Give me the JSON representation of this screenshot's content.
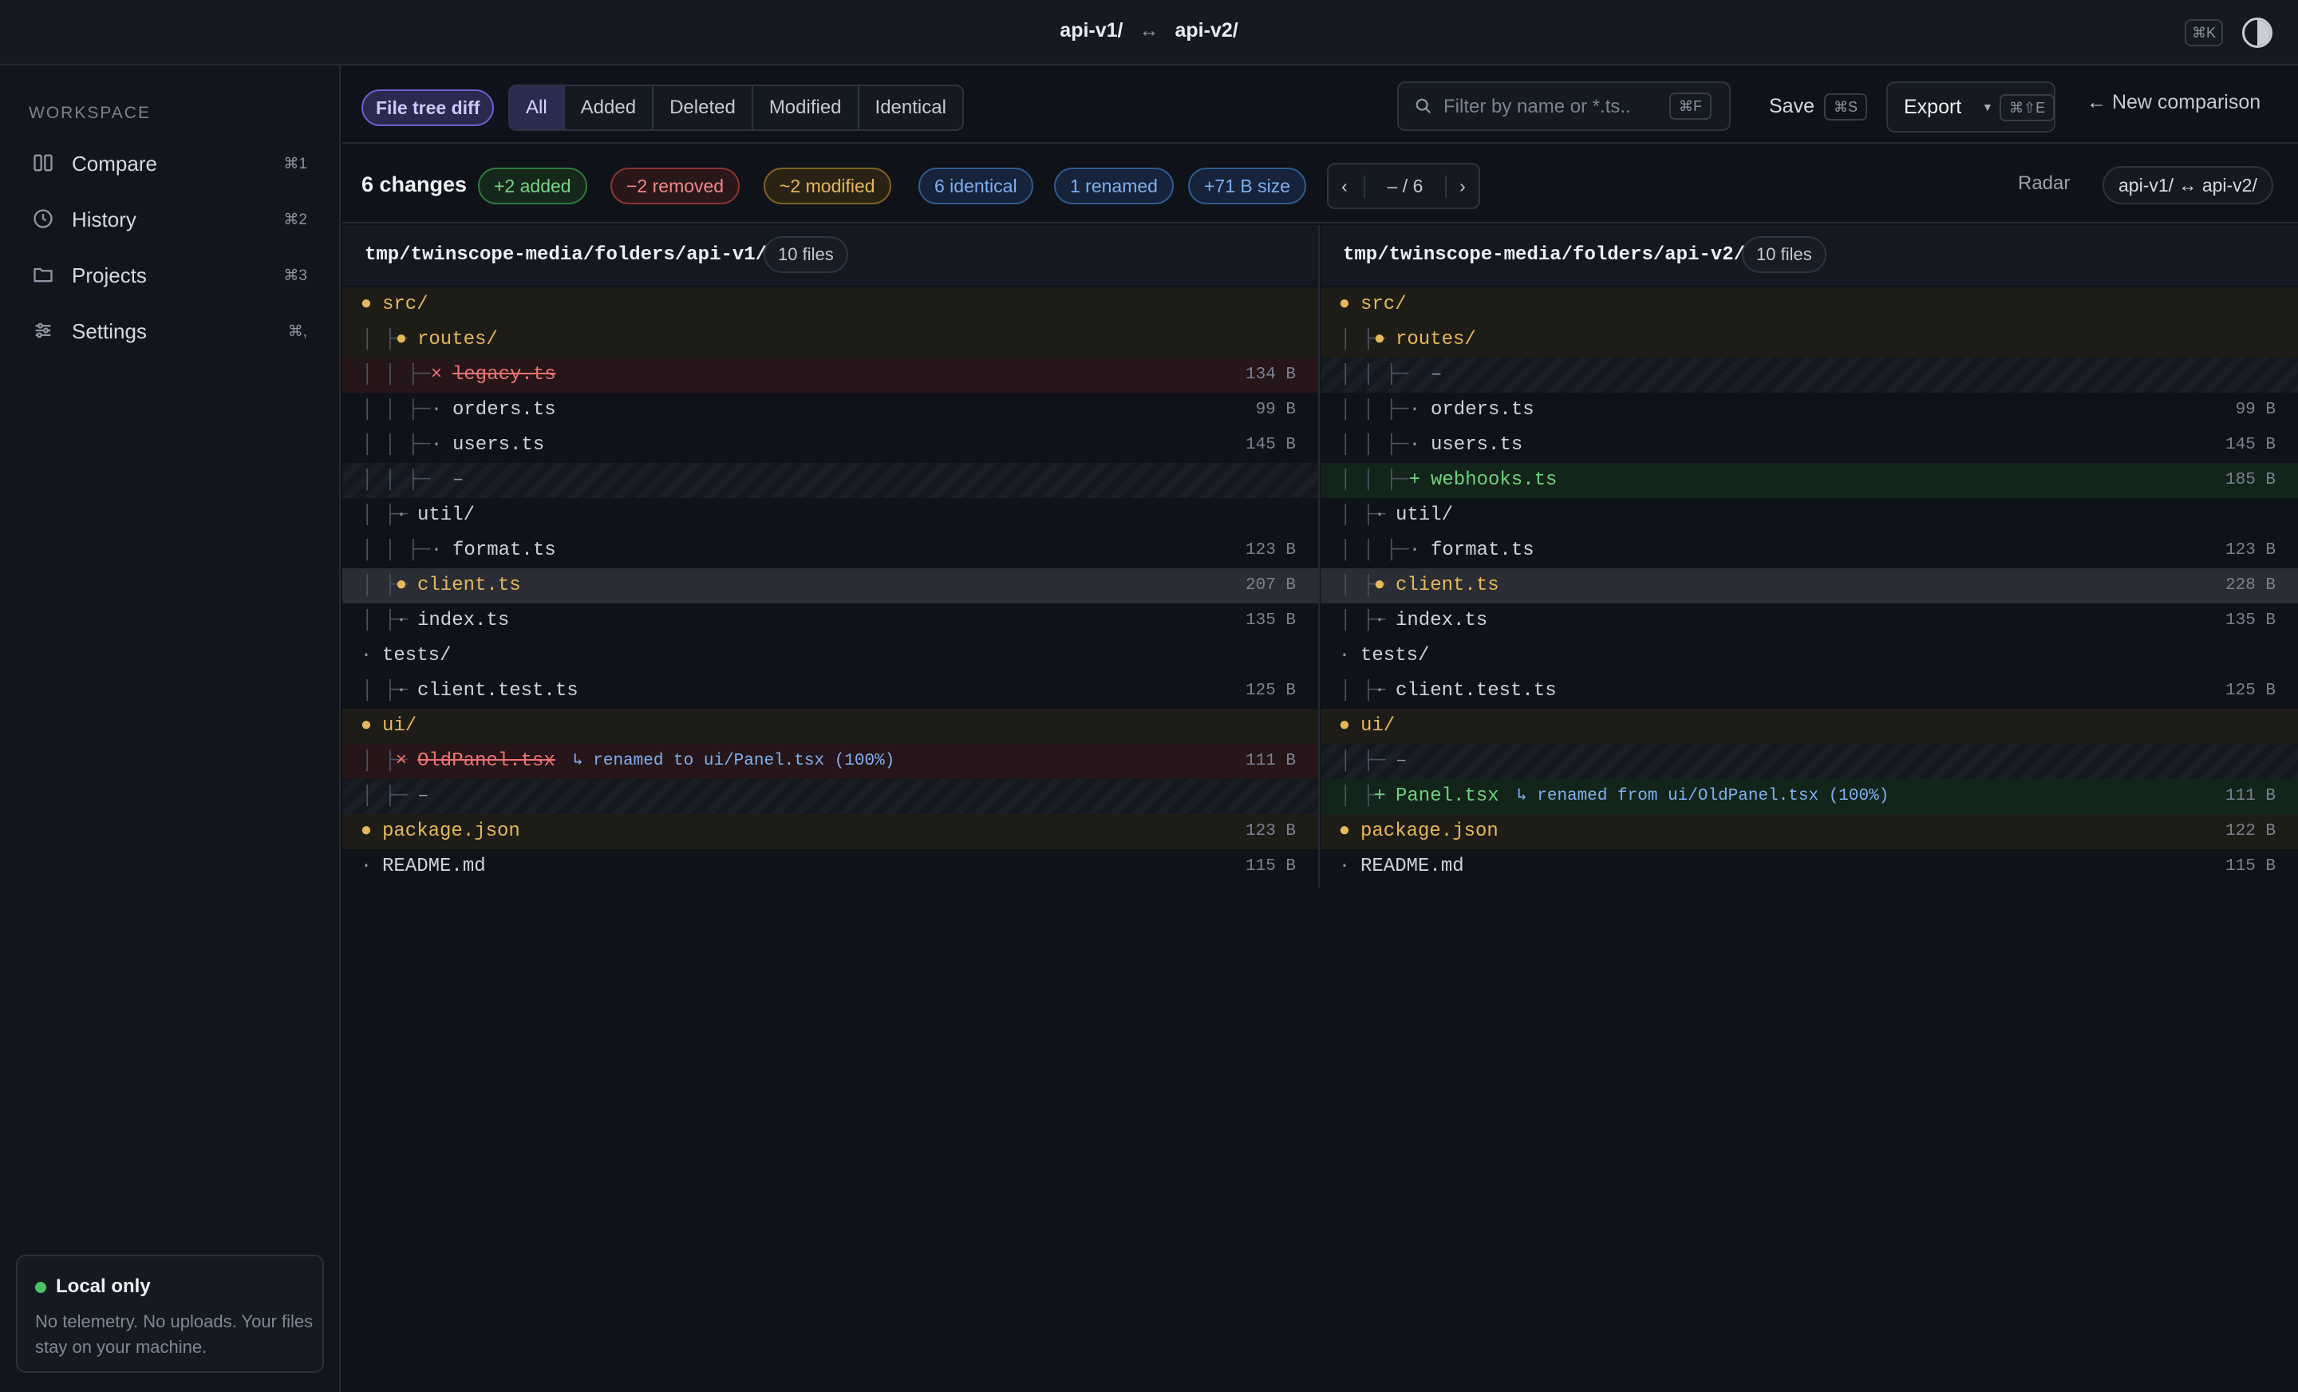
{
  "header": {
    "left_folder": "api-v1/",
    "arrow": "↔",
    "right_folder": "api-v2/",
    "command_kbd": "⌘K",
    "theme_toggle_icon": "half-circle-icon"
  },
  "sidebar": {
    "section_label": "WORKSPACE",
    "items": [
      {
        "label": "Compare",
        "shortcut": "⌘1",
        "icon": "columns-icon"
      },
      {
        "label": "History",
        "shortcut": "⌘2",
        "icon": "clock-icon"
      },
      {
        "label": "Projects",
        "shortcut": "⌘3",
        "icon": "folder-icon"
      },
      {
        "label": "Settings",
        "shortcut": "⌘,",
        "icon": "sliders-icon"
      }
    ],
    "status": {
      "title": "Local only",
      "description": "No telemetry. No uploads. Your files stay on your machine.",
      "color": "#4cc163"
    }
  },
  "toolbar": {
    "mode": "File tree diff",
    "filters": [
      "All",
      "Added",
      "Deleted",
      "Modified",
      "Identical"
    ],
    "active_filter": "All",
    "search_placeholder": "Filter by name or *.ts..",
    "search_value": "",
    "search_kbd": "⌘F",
    "save_label": "Save",
    "save_kbd": "⌘S",
    "export_label": "Export",
    "export_kbd": "⌘⇧E",
    "new_comparison": "← New comparison"
  },
  "summary": {
    "changes": "6 changes",
    "added": "+2 added",
    "removed": "−2 removed",
    "modified": "~2 modified",
    "identical": "6 identical",
    "renamed": "1 renamed",
    "size": "+71 B size",
    "pager_prev": "‹",
    "pager_next": "›",
    "pager_info": "– / 6",
    "radar": "Radar",
    "pair": "api-v1/ ↔ api-v2/"
  },
  "colors": {
    "modified": "#e4b85b",
    "removed": "#f07272",
    "added": "#6fd17e",
    "renamed": "#7fb0f0",
    "accent": "#6b5fd0"
  },
  "left": {
    "path": "tmp/twinscope-media/folders/api-v1/",
    "files": "10 files",
    "rows": [
      {
        "tree": "",
        "level": 0,
        "mark": "●",
        "name": "src/",
        "size": "",
        "status": "modified"
      },
      {
        "tree": "│  ├─",
        "level": 1,
        "mark": "●",
        "name": "routes/",
        "size": "",
        "status": "modified"
      },
      {
        "tree": "│  │  ├─",
        "level": 2,
        "mark": "×",
        "name": "legacy.ts",
        "size": "134 B",
        "status": "removed"
      },
      {
        "tree": "│  │  ├─",
        "level": 2,
        "mark": "·",
        "name": "orders.ts",
        "size": "99 B",
        "status": "identical"
      },
      {
        "tree": "│  │  ├─",
        "level": 2,
        "mark": "·",
        "name": "users.ts",
        "size": "145 B",
        "status": "identical"
      },
      {
        "tree": "│  │  ├─",
        "level": 2,
        "mark": "",
        "name": "–",
        "size": "",
        "status": "placeholder"
      },
      {
        "tree": "│  ├─",
        "level": 1,
        "mark": "·",
        "name": "util/",
        "size": "",
        "status": "identical"
      },
      {
        "tree": "│  │  ├─",
        "level": 2,
        "mark": "·",
        "name": "format.ts",
        "size": "123 B",
        "status": "identical"
      },
      {
        "tree": "│  ├─",
        "level": 1,
        "mark": "●",
        "name": "client.ts",
        "size": "207 B",
        "status": "modified-selected"
      },
      {
        "tree": "│  ├─",
        "level": 1,
        "mark": "·",
        "name": "index.ts",
        "size": "135 B",
        "status": "identical"
      },
      {
        "tree": "",
        "level": 0,
        "mark": "·",
        "name": "tests/",
        "size": "",
        "status": "identical"
      },
      {
        "tree": "│  ├─",
        "level": 1,
        "mark": "·",
        "name": "client.test.ts",
        "size": "125 B",
        "status": "identical"
      },
      {
        "tree": "",
        "level": 0,
        "mark": "●",
        "name": "ui/",
        "size": "",
        "status": "modified"
      },
      {
        "tree": "│  ├─",
        "level": 1,
        "mark": "×",
        "name": "OldPanel.tsx",
        "size": "111 B",
        "status": "removed",
        "note": "↳ renamed to ui/Panel.tsx (100%)"
      },
      {
        "tree": "│  ├─",
        "level": 1,
        "mark": "",
        "name": "–",
        "size": "",
        "status": "placeholder"
      },
      {
        "tree": "",
        "level": 0,
        "mark": "●",
        "name": "package.json",
        "size": "123 B",
        "status": "modified"
      },
      {
        "tree": "",
        "level": 0,
        "mark": "·",
        "name": "README.md",
        "size": "115 B",
        "status": "identical"
      }
    ]
  },
  "right": {
    "path": "tmp/twinscope-media/folders/api-v2/",
    "files": "10 files",
    "rows": [
      {
        "tree": "",
        "level": 0,
        "mark": "●",
        "name": "src/",
        "size": "",
        "status": "modified"
      },
      {
        "tree": "│  ├─",
        "level": 1,
        "mark": "●",
        "name": "routes/",
        "size": "",
        "status": "modified"
      },
      {
        "tree": "│  │  ├─",
        "level": 2,
        "mark": "",
        "name": "–",
        "size": "",
        "status": "placeholder"
      },
      {
        "tree": "│  │  ├─",
        "level": 2,
        "mark": "·",
        "name": "orders.ts",
        "size": "99 B",
        "status": "identical"
      },
      {
        "tree": "│  │  ├─",
        "level": 2,
        "mark": "·",
        "name": "users.ts",
        "size": "145 B",
        "status": "identical"
      },
      {
        "tree": "│  │  ├─",
        "level": 2,
        "mark": "+",
        "name": "webhooks.ts",
        "size": "185 B",
        "status": "added"
      },
      {
        "tree": "│  ├─",
        "level": 1,
        "mark": "·",
        "name": "util/",
        "size": "",
        "status": "identical"
      },
      {
        "tree": "│  │  ├─",
        "level": 2,
        "mark": "·",
        "name": "format.ts",
        "size": "123 B",
        "status": "identical"
      },
      {
        "tree": "│  ├─",
        "level": 1,
        "mark": "●",
        "name": "client.ts",
        "size": "228 B",
        "status": "modified-selected"
      },
      {
        "tree": "│  ├─",
        "level": 1,
        "mark": "·",
        "name": "index.ts",
        "size": "135 B",
        "status": "identical"
      },
      {
        "tree": "",
        "level": 0,
        "mark": "·",
        "name": "tests/",
        "size": "",
        "status": "identical"
      },
      {
        "tree": "│  ├─",
        "level": 1,
        "mark": "·",
        "name": "client.test.ts",
        "size": "125 B",
        "status": "identical"
      },
      {
        "tree": "",
        "level": 0,
        "mark": "●",
        "name": "ui/",
        "size": "",
        "status": "modified"
      },
      {
        "tree": "│  ├─",
        "level": 1,
        "mark": "",
        "name": "–",
        "size": "",
        "status": "placeholder"
      },
      {
        "tree": "│  ├─",
        "level": 1,
        "mark": "+",
        "name": "Panel.tsx",
        "size": "111 B",
        "status": "added",
        "note": "↳ renamed from ui/OldPanel.tsx (100%)"
      },
      {
        "tree": "",
        "level": 0,
        "mark": "●",
        "name": "package.json",
        "size": "122 B",
        "status": "modified"
      },
      {
        "tree": "",
        "level": 0,
        "mark": "·",
        "name": "README.md",
        "size": "115 B",
        "status": "identical"
      }
    ]
  }
}
